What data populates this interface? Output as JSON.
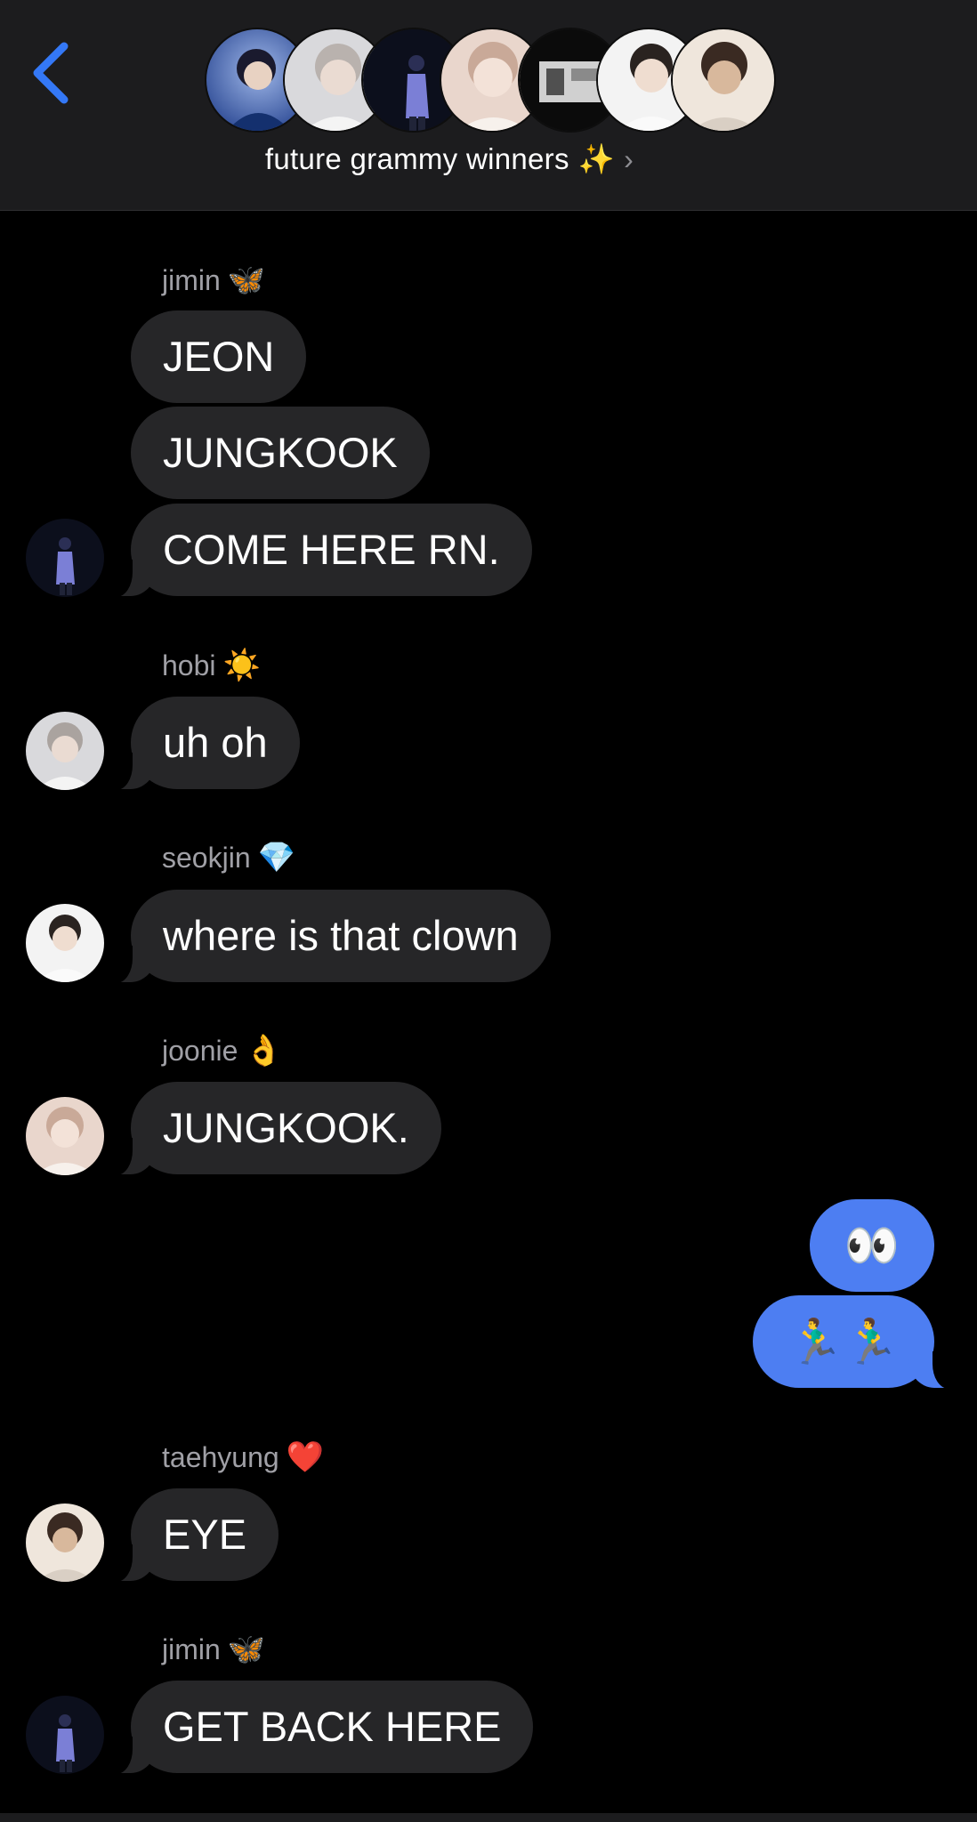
{
  "header": {
    "back_icon": "chevron-left-icon",
    "group_name": "future grammy winners",
    "group_emoji": "✨",
    "chevron": "›",
    "members": [
      {
        "name": "member-1",
        "colors": [
          "#3a5fb0",
          "#9fb7e8"
        ]
      },
      {
        "name": "member-2",
        "colors": [
          "#b8bcc4",
          "#e8e8ea"
        ]
      },
      {
        "name": "member-3",
        "colors": [
          "#0f1424",
          "#4a5aa8"
        ]
      },
      {
        "name": "member-4",
        "colors": [
          "#d7b8a4",
          "#f2e4dc"
        ]
      },
      {
        "name": "member-5",
        "colors": [
          "#101010",
          "#bdbdbd"
        ]
      },
      {
        "name": "member-6",
        "colors": [
          "#e6e6e6",
          "#f6f6f6"
        ]
      },
      {
        "name": "member-7",
        "colors": [
          "#c9b49c",
          "#f0e6dc"
        ]
      }
    ]
  },
  "messages": [
    {
      "sender": "jimin",
      "emoji": "🦋",
      "texts": [
        "JEON",
        "JUNGKOOK",
        "COME HERE RN."
      ]
    },
    {
      "sender": "hobi",
      "emoji": "☀️",
      "texts": [
        "uh oh"
      ]
    },
    {
      "sender": "seokjin",
      "emoji": "💎",
      "texts": [
        "where is that clown"
      ]
    },
    {
      "sender": "joonie",
      "emoji": "👌",
      "texts": [
        "JUNGKOOK."
      ]
    },
    {
      "sender": "me",
      "texts": [
        "👀",
        "🏃‍♂️🏃‍♂️"
      ]
    },
    {
      "sender": "taehyung",
      "emoji": "❤️",
      "texts": [
        "EYE"
      ]
    },
    {
      "sender": "jimin",
      "emoji": "🦋",
      "texts": [
        "GET BACK HERE"
      ]
    }
  ],
  "colors": {
    "accent": "#3478f6",
    "incoming_bubble": "#262628",
    "outgoing_bubble": "#4d7ef2",
    "header_bg": "#1c1c1e",
    "sender_label": "#a0a0a6"
  }
}
